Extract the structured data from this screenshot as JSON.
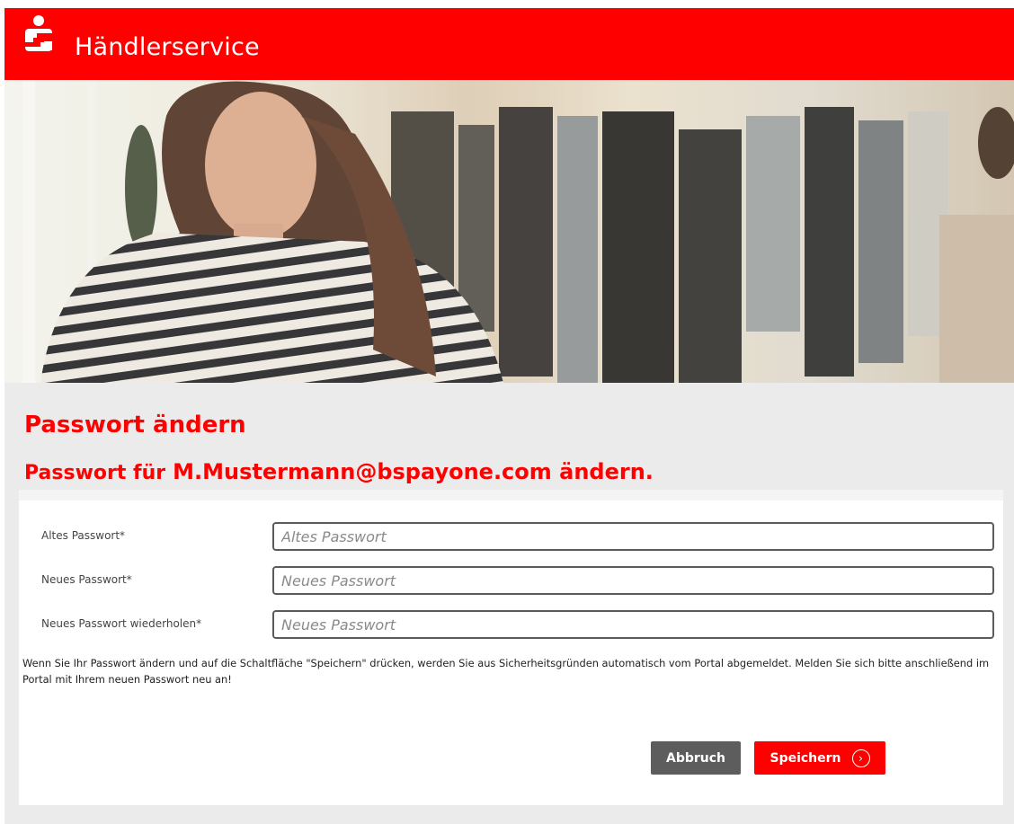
{
  "header": {
    "brand": "Händlerservice",
    "logo_icon": "sparkasse-s-icon",
    "color": "#ff0000"
  },
  "hero": {
    "image": "woman-in-striped-shirt-clothing-store-photo"
  },
  "page": {
    "title": "Passwort ändern",
    "subtitle_prefix": "Passwort für",
    "subtitle_user": "M.Mustermann@bspayone.com ändern."
  },
  "form": {
    "old_password": {
      "label": "Altes Passwort*",
      "placeholder": "Altes Passwort",
      "value": ""
    },
    "new_password": {
      "label": "Neues Passwort*",
      "placeholder": "Neues Passwort",
      "value": ""
    },
    "repeat_password": {
      "label": "Neues Passwort wiederholen*",
      "placeholder": "Neues Passwort",
      "value": ""
    },
    "notice": "Wenn Sie Ihr Passwort ändern und auf die Schaltfläche \"Speichern\" drücken, werden Sie aus Sicherheitsgründen automatisch vom Portal abgemeldet. Melden Sie sich bitte anschließend im Portal mit Ihrem neuen Passwort neu an!"
  },
  "buttons": {
    "cancel": "Abbruch",
    "save": "Speichern",
    "save_icon": "chevron-right-circle-icon"
  },
  "colors": {
    "brand_red": "#ff0000",
    "cancel_gray": "#5d5d5d",
    "background": "#ebebeb"
  }
}
